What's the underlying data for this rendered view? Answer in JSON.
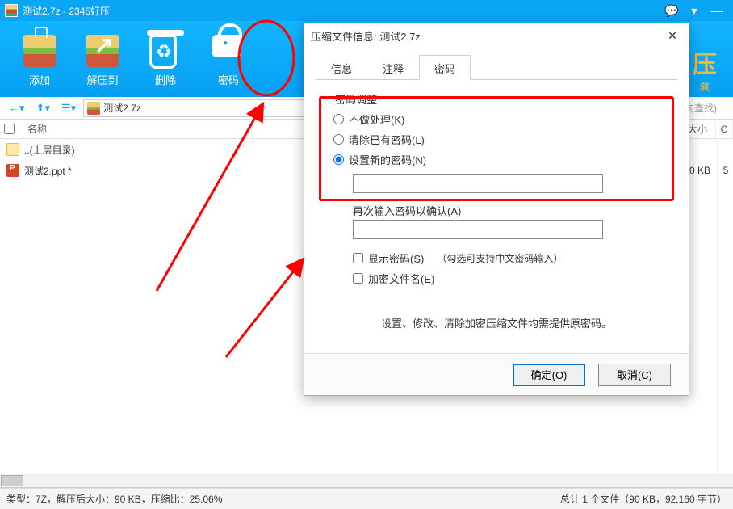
{
  "titlebar": {
    "title": "测试2.7z - 2345好压"
  },
  "toolbar": {
    "add": "添加",
    "extract": "解压到",
    "delete": "删除",
    "password": "密码",
    "badge_big": "压",
    "badge_small": "藏"
  },
  "nav": {
    "back": "←",
    "up": "⬆",
    "list": "☰",
    "archive": "测试2.7z",
    "search_hint": "向查找)"
  },
  "columns": {
    "name": "名称",
    "size": "大小",
    "right": "C"
  },
  "files": [
    {
      "name": "..(上层目录)",
      "icon": "folder",
      "size": ""
    },
    {
      "name": "测试2.ppt *",
      "icon": "ppt",
      "size": "90 KB",
      "right_cell": "5"
    }
  ],
  "status": {
    "left": "类型：7Z，解压后大小：90 KB，压缩比：25.06%",
    "right": "总计 1 个文件（90 KB，92,160 字节）"
  },
  "dialog": {
    "title": "压缩文件信息: 测试2.7z",
    "tabs": {
      "info": "信息",
      "comment": "注释",
      "password": "密码"
    },
    "group_label": "密码调整",
    "opt_keep": "不做处理(K)",
    "opt_clear": "清除已有密码(L)",
    "opt_set": "设置新的密码(N)",
    "confirm_label": "再次输入密码以确认(A)",
    "show_pwd": "显示密码(S)",
    "support_cn": "（勾选可支持中文密码输入）",
    "encrypt_names": "加密文件名(E)",
    "note": "设置、修改、清除加密压缩文件均需提供原密码。",
    "ok": "确定(O)",
    "cancel": "取消(C)"
  }
}
